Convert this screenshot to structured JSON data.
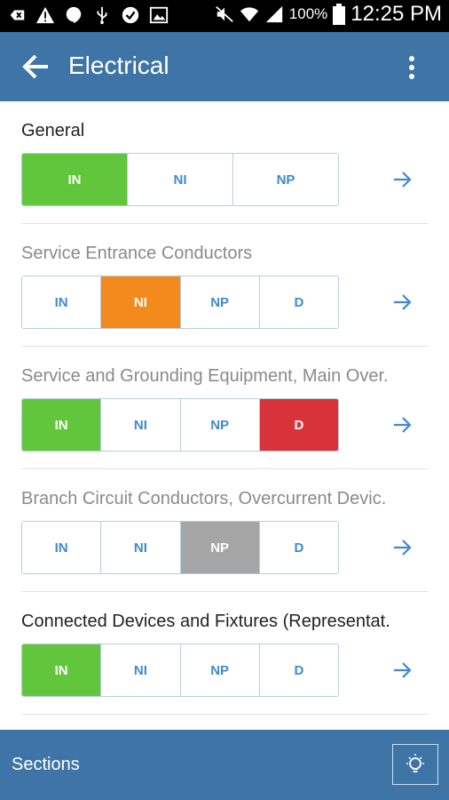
{
  "status_bar": {
    "battery_percent": "100%",
    "time": "12:25 PM"
  },
  "app_bar": {
    "title": "Electrical"
  },
  "sections": [
    {
      "title": "General",
      "muted": false,
      "options": [
        "IN",
        "NI",
        "NP"
      ],
      "selected": "IN"
    },
    {
      "title": "Service Entrance Conductors",
      "muted": true,
      "options": [
        "IN",
        "NI",
        "NP",
        "D"
      ],
      "selected": "NI"
    },
    {
      "title": "Service and Grounding Equipment, Main Over.",
      "muted": true,
      "options": [
        "IN",
        "NI",
        "NP",
        "D"
      ],
      "selected": [
        "IN",
        "D"
      ]
    },
    {
      "title": "Branch Circuit Conductors, Overcurrent Devic.",
      "muted": true,
      "options": [
        "IN",
        "NI",
        "NP",
        "D"
      ],
      "selected": "NP"
    },
    {
      "title": "Connected Devices and Fixtures (Representat.",
      "muted": false,
      "options": [
        "IN",
        "NI",
        "NP",
        "D"
      ],
      "selected": "IN"
    }
  ],
  "bottom_bar": {
    "label": "Sections"
  },
  "colors": {
    "primary": "#3f75a6",
    "in": "#62c63c",
    "ni": "#f28a1e",
    "np": "#a6a6a6",
    "d": "#d8323a",
    "link": "#3f8ad0"
  },
  "icons": [
    "back-arrow-icon",
    "overflow-menu-icon",
    "chevron-right-arrow-icon",
    "lightbulb-icon"
  ]
}
